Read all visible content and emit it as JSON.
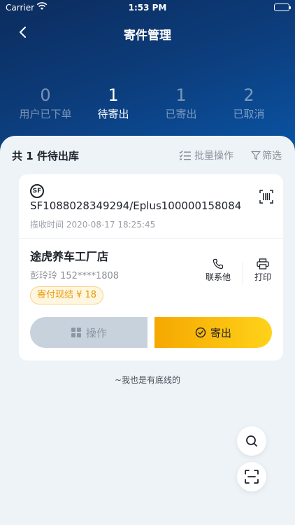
{
  "status_bar": {
    "carrier": "Carrier",
    "time": "1:53 PM"
  },
  "nav": {
    "title": "寄件管理"
  },
  "stats": [
    {
      "count": "0",
      "label": "用户已下单",
      "active": false
    },
    {
      "count": "1",
      "label": "待寄出",
      "active": true
    },
    {
      "count": "1",
      "label": "已寄出",
      "active": false
    },
    {
      "count": "2",
      "label": "已取消",
      "active": false
    }
  ],
  "list": {
    "summary": "共 1 件待出库",
    "batch_label": "批量操作",
    "filter_label": "筛选"
  },
  "order": {
    "carrier_logo": "SF",
    "tracking": "SF1088028349294/Eplus100000158084",
    "received_time": "揽收时间 2020-08-17 18:25:45",
    "store_name": "途虎养车工厂店",
    "contact": "彭玲玲 152****1808",
    "fee": "寄付现结 ¥ 18",
    "call_label": "联系他",
    "print_label": "打印",
    "operate_label": "操作",
    "ship_label": "寄出"
  },
  "footer": {
    "bottom_line": "~我也是有底线的"
  },
  "colors": {
    "accent": "#f5a800",
    "header": "#0c3c7a",
    "fee": "#e59b0a"
  },
  "icons": [
    "back-arrow-icon",
    "batch-list-icon",
    "filter-icon",
    "barcode-icon",
    "phone-icon",
    "printer-icon",
    "grid-icon",
    "check-circle-icon",
    "search-icon",
    "scan-icon",
    "wifi-icon",
    "battery-icon"
  ]
}
